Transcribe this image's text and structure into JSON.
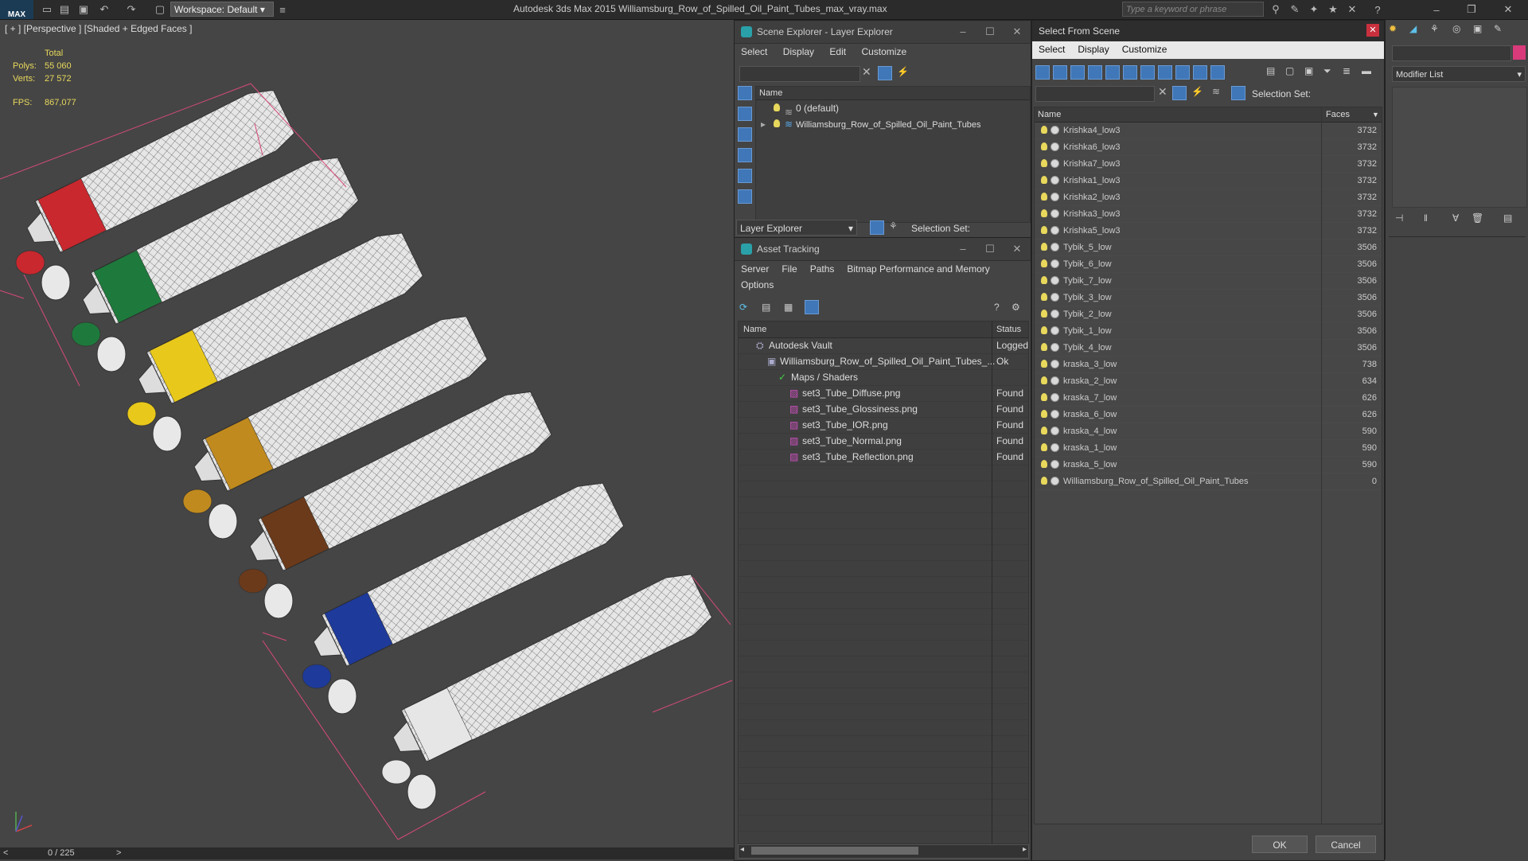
{
  "app_title": "Autodesk 3ds Max  2015    Williamsburg_Row_of_Spilled_Oil_Paint_Tubes_max_vray.max",
  "logo_text": "MAX",
  "workspace_label": "Workspace: Default",
  "search_placeholder": "Type a keyword or phrase",
  "viewport": {
    "label": "[ + ] [Perspective ] [Shaded + Edged Faces ]",
    "stats_header": "Total",
    "polys_label": "Polys:",
    "polys_value": "55 060",
    "verts_label": "Verts:",
    "verts_value": "27 572",
    "fps_label": "FPS:",
    "fps_value": "867,077"
  },
  "timeline": {
    "frame": "0 / 225",
    "prev": "<",
    "next": ">"
  },
  "scene_explorer": {
    "title": "Scene Explorer - Layer Explorer",
    "menus": [
      "Select",
      "Display",
      "Edit",
      "Customize"
    ],
    "name_header": "Name",
    "layers": [
      "0 (default)",
      "Williamsburg_Row_of_Spilled_Oil_Paint_Tubes"
    ],
    "footer_combo": "Layer Explorer",
    "selection_set_label": "Selection Set:"
  },
  "asset_tracking": {
    "title": "Asset Tracking",
    "menus": [
      "Server",
      "File",
      "Paths",
      "Bitmap Performance and Memory"
    ],
    "menus2": [
      "Options"
    ],
    "col_name": "Name",
    "col_status": "Status",
    "rows": [
      {
        "name": "Autodesk Vault",
        "status": "Logged",
        "indent": 0
      },
      {
        "name": "Williamsburg_Row_of_Spilled_Oil_Paint_Tubes_...",
        "status": "Ok",
        "indent": 1
      },
      {
        "name": "Maps / Shaders",
        "status": "",
        "indent": 2
      },
      {
        "name": "set3_Tube_Diffuse.png",
        "status": "Found",
        "indent": 3
      },
      {
        "name": "set3_Tube_Glossiness.png",
        "status": "Found",
        "indent": 3
      },
      {
        "name": "set3_Tube_IOR.png",
        "status": "Found",
        "indent": 3
      },
      {
        "name": "set3_Tube_Normal.png",
        "status": "Found",
        "indent": 3
      },
      {
        "name": "set3_Tube_Reflection.png",
        "status": "Found",
        "indent": 3
      }
    ]
  },
  "select_from_scene": {
    "title": "Select From Scene",
    "menus": [
      "Select",
      "Display",
      "Customize"
    ],
    "selection_set_label": "Selection Set:",
    "col_name": "Name",
    "col_faces": "Faces",
    "rows": [
      {
        "name": "Krishka4_low3",
        "faces": "3732"
      },
      {
        "name": "Krishka6_low3",
        "faces": "3732"
      },
      {
        "name": "Krishka7_low3",
        "faces": "3732"
      },
      {
        "name": "Krishka1_low3",
        "faces": "3732"
      },
      {
        "name": "Krishka2_low3",
        "faces": "3732"
      },
      {
        "name": "Krishka3_low3",
        "faces": "3732"
      },
      {
        "name": "Krishka5_low3",
        "faces": "3732"
      },
      {
        "name": "Tybik_5_low",
        "faces": "3506"
      },
      {
        "name": "Tybik_6_low",
        "faces": "3506"
      },
      {
        "name": "Tybik_7_low",
        "faces": "3506"
      },
      {
        "name": "Tybik_3_low",
        "faces": "3506"
      },
      {
        "name": "Tybik_2_low",
        "faces": "3506"
      },
      {
        "name": "Tybik_1_low",
        "faces": "3506"
      },
      {
        "name": "Tybik_4_low",
        "faces": "3506"
      },
      {
        "name": "kraska_3_low",
        "faces": "738"
      },
      {
        "name": "kraska_2_low",
        "faces": "634"
      },
      {
        "name": "kraska_7_low",
        "faces": "626"
      },
      {
        "name": "kraska_6_low",
        "faces": "626"
      },
      {
        "name": "kraska_4_low",
        "faces": "590"
      },
      {
        "name": "kraska_1_low",
        "faces": "590"
      },
      {
        "name": "kraska_5_low",
        "faces": "590"
      },
      {
        "name": "Williamsburg_Row_of_Spilled_Oil_Paint_Tubes",
        "faces": "0"
      }
    ],
    "ok_label": "OK",
    "cancel_label": "Cancel"
  },
  "command_panel": {
    "modifier_list": "Modifier List"
  },
  "colors": {
    "red": "#c8282e",
    "green": "#1e7a3c",
    "yellow": "#e8c81a",
    "ochre": "#c08a1e",
    "brown": "#6b3a1a",
    "blue": "#1e3a9a",
    "white": "#e6e6e6"
  }
}
